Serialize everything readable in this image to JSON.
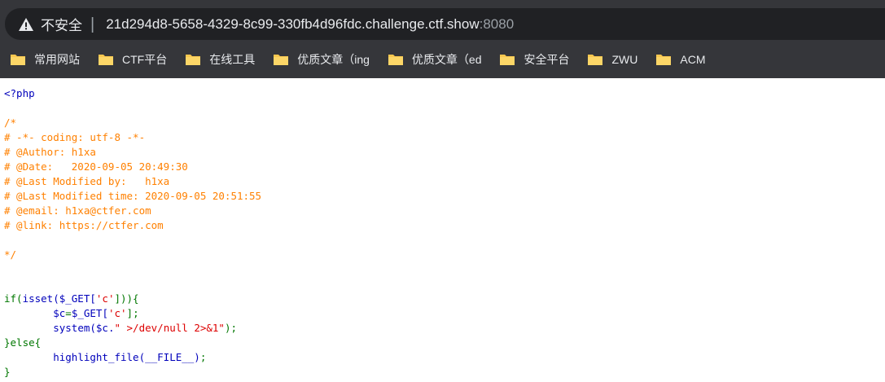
{
  "addressbar": {
    "security_label": "不安全",
    "separator": "|",
    "host": "21d294d8-5658-4329-8c99-330fb4d96fdc.challenge.ctf.show",
    "port": ":8080"
  },
  "bookmarks": {
    "items": [
      {
        "label": "常用网站",
        "icon": "folder-icon"
      },
      {
        "label": "CTF平台",
        "icon": "folder-icon"
      },
      {
        "label": "在线工具",
        "icon": "folder-icon"
      },
      {
        "label": "优质文章（ing",
        "icon": "folder-icon"
      },
      {
        "label": "优质文章（ed",
        "icon": "folder-icon"
      },
      {
        "label": "安全平台",
        "icon": "folder-icon"
      },
      {
        "label": "ZWU",
        "icon": "folder-icon"
      },
      {
        "label": "ACM",
        "icon": "folder-icon"
      }
    ]
  },
  "source": {
    "open_tag": "<?php",
    "comment_lines": [
      "/*",
      "# -*- coding: utf-8 -*-",
      "# @Author: h1xa",
      "# @Date:   2020-09-05 20:49:30",
      "# @Last Modified by:   h1xa",
      "# @Last Modified time: 2020-09-05 20:51:55",
      "# @email: h1xa@ctfer.com",
      "# @link: https://ctfer.com",
      "",
      "*/"
    ],
    "if_kw": "if(",
    "isset_call": "isset($_GET[",
    "key_c1": "'c'",
    "close_if": "])){",
    "assign_lhs": "$c",
    "assign_eq": "=",
    "assign_rhs": "$_GET[",
    "key_c2": "'c'",
    "assign_end": "];",
    "system_call": "system($c.",
    "system_str": "\" >/dev/null 2>&1\"",
    "system_end": ");",
    "else_kw": "}else{",
    "highlight_call": "highlight_file(__FILE__)",
    "highlight_end": ";",
    "close_brace": "}"
  },
  "colors": {
    "chrome_bg": "#35363a",
    "addressbar_bg": "#202124",
    "folder": "#f9c74f",
    "php_default": "#0000bb",
    "php_comment": "#ff8000",
    "php_keyword": "#007700",
    "php_string": "#dd0000"
  }
}
